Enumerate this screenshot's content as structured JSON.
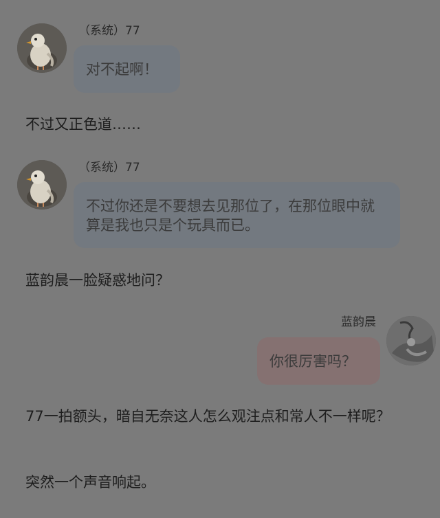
{
  "messages": [
    {
      "sender": "（系统）77",
      "text": "对不起啊！"
    },
    {
      "sender": "（系统）77",
      "text": "不过你还是不要想去见那位了，在那位眼中就算是我也只是个玩具而已。"
    },
    {
      "sender": "蓝韵晨",
      "text": "你很厉害吗？"
    }
  ],
  "narration": [
    "不过又正色道……",
    "蓝韵晨一脸疑惑地问？",
    "77一拍额头，暗自无奈这人怎么观注点和常人不一样呢？",
    "突然一个声音响起。"
  ],
  "avatars": {
    "system": "bird-avatar-icon",
    "user": "abstract-avatar-icon"
  },
  "colors": {
    "page_bg": "#7b7b7b",
    "left_bubble": "#737980",
    "right_bubble": "#857171"
  }
}
